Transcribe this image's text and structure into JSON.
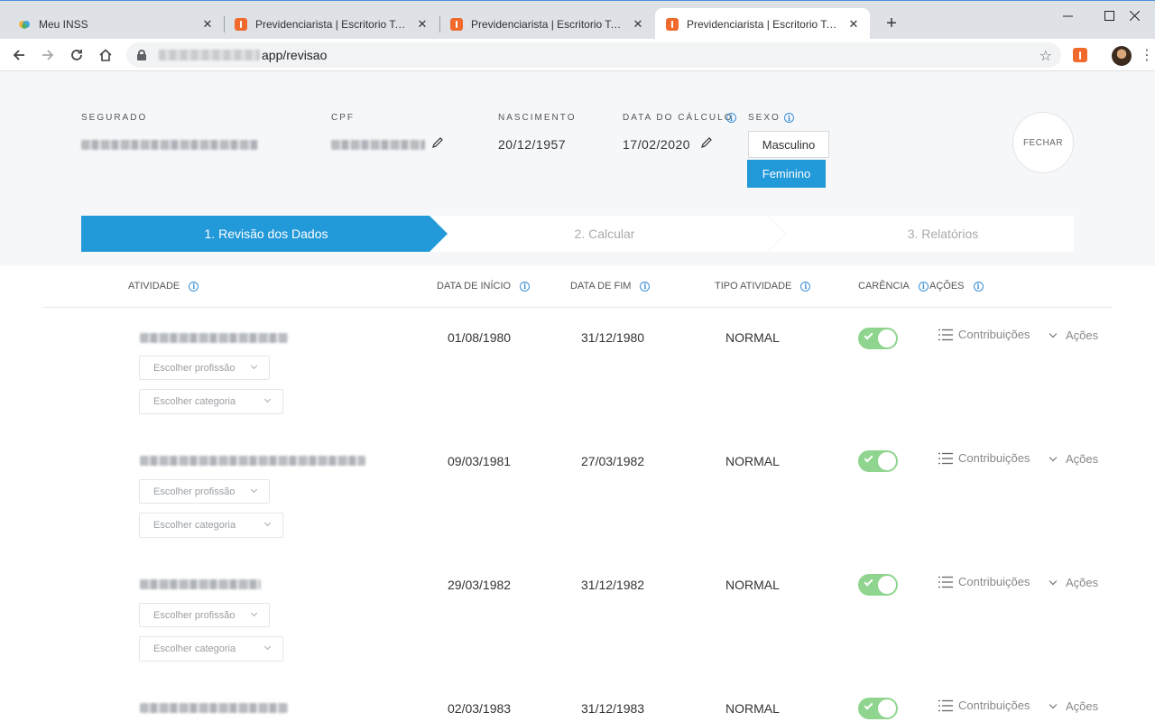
{
  "browser": {
    "tabs": [
      {
        "title": "Meu INSS",
        "active": false
      },
      {
        "title": "Previdenciarista | Escritorio Teste",
        "active": false
      },
      {
        "title": "Previdenciarista | Escritorio Teste",
        "active": false
      },
      {
        "title": "Previdenciarista | Escritorio Teste",
        "active": true
      }
    ],
    "url_path": "app/revisao"
  },
  "header": {
    "segurado_label": "SEGURADO",
    "cpf_label": "CPF",
    "nascimento_label": "NASCIMENTO",
    "nascimento_value": "20/12/1957",
    "data_calculo_label": "DATA DO CÁLCULO",
    "data_calculo_value": "17/02/2020",
    "sexo_label": "SEXO",
    "sexo_options": [
      "Masculino",
      "Feminino"
    ],
    "sexo_selected": "Feminino",
    "fechar_label": "FECHAR"
  },
  "steps": [
    {
      "label": "1. Revisão dos Dados",
      "active": true
    },
    {
      "label": "2. Calcular",
      "active": false
    },
    {
      "label": "3. Relatórios",
      "active": false
    }
  ],
  "table": {
    "columns": {
      "atividade": "ATIVIDADE",
      "data_inicio": "DATA DE INÍCIO",
      "data_fim": "DATA DE FIM",
      "tipo_atividade": "TIPO ATIVIDADE",
      "carencia": "CARÊNCIA",
      "acoes": "AÇÕES"
    },
    "profissao_placeholder": "Escolher profissão",
    "categoria_placeholder": "Escolher categoria",
    "contribuicoes_label": "Contribuições",
    "acoes_label": "Ações",
    "rows": [
      {
        "data_inicio": "01/08/1980",
        "data_fim": "31/12/1980",
        "tipo": "NORMAL",
        "carencia": true
      },
      {
        "data_inicio": "09/03/1981",
        "data_fim": "27/03/1982",
        "tipo": "NORMAL",
        "carencia": true
      },
      {
        "data_inicio": "29/03/1982",
        "data_fim": "31/12/1982",
        "tipo": "NORMAL",
        "carencia": true
      },
      {
        "data_inicio": "02/03/1983",
        "data_fim": "31/12/1983",
        "tipo": "NORMAL",
        "carencia": true
      }
    ]
  }
}
